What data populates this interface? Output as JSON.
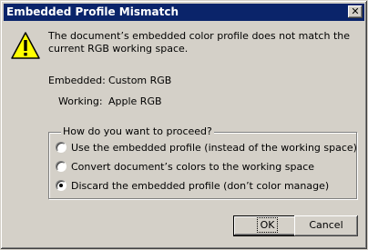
{
  "window": {
    "title": "Embedded Profile Mismatch",
    "close_glyph": "✕"
  },
  "message": "The document’s embedded color profile does not match the current RGB working space.",
  "profiles": {
    "embedded_label": "Embedded:",
    "embedded_value": "Custom RGB",
    "working_label": "Working:",
    "working_value": "Apple RGB"
  },
  "options": {
    "group_label": "How do you want to proceed?",
    "items": [
      {
        "label": "Use the embedded profile (instead of the working space)",
        "selected": false
      },
      {
        "label": "Convert document’s colors to the working space",
        "selected": false
      },
      {
        "label": "Discard the embedded profile (don’t color manage)",
        "selected": true
      }
    ]
  },
  "buttons": {
    "ok_label": "OK",
    "cancel_label": "Cancel"
  },
  "icons": {
    "warning": "warning-triangle-icon"
  },
  "colors": {
    "titlebar": "#0a246a",
    "face": "#d4d0c8",
    "warning_fill": "#ffff00"
  }
}
